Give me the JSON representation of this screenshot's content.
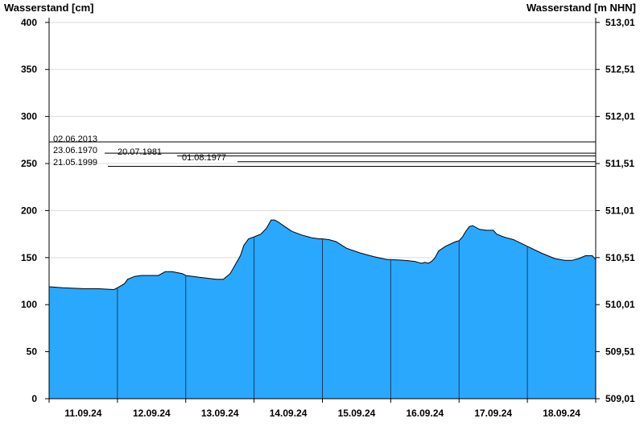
{
  "chart_data": {
    "type": "area",
    "title": "",
    "ylabel_left": "Wasserstand [cm]",
    "ylabel_right": "Wasserstand [m NHN]",
    "ylim": [
      0,
      405
    ],
    "yticks_left": [
      "0",
      "50",
      "100",
      "150",
      "200",
      "250",
      "300",
      "350",
      "400"
    ],
    "yticks_right": [
      "509,01",
      "509,51",
      "510,01",
      "510,51",
      "511,01",
      "511,51",
      "512,01",
      "512,51",
      "513,01"
    ],
    "x_day_labels": [
      "11.09.24",
      "12.09.24",
      "13.09.24",
      "14.09.24",
      "15.09.24",
      "16.09.24",
      "17.09.24",
      "18.09.24"
    ],
    "x_range_days": [
      0,
      8
    ],
    "grid": true,
    "fill_color": "#2aa8fe",
    "line_color": "#000000",
    "series": [
      {
        "x": [
          0,
          0.2,
          0.5,
          0.7,
          0.95,
          1.0,
          1.1,
          1.15,
          1.25,
          1.35,
          1.5,
          1.6,
          1.7,
          1.8,
          1.95,
          2.0,
          2.2,
          2.45,
          2.55,
          2.65,
          2.72,
          2.8,
          2.85,
          2.92,
          3.0,
          3.1,
          3.18,
          3.25,
          3.3,
          3.35,
          3.45,
          3.55,
          3.7,
          3.85,
          3.95,
          4.0,
          4.1,
          4.2,
          4.35,
          4.55,
          4.75,
          4.95,
          5.0,
          5.2,
          5.35,
          5.4,
          5.45,
          5.5,
          5.55,
          5.6,
          5.65,
          5.7,
          5.8,
          5.95,
          6.0,
          6.05,
          6.1,
          6.15,
          6.2,
          6.3,
          6.4,
          6.5,
          6.55,
          6.65,
          6.8,
          7.0,
          7.2,
          7.4,
          7.55,
          7.65,
          7.75,
          7.85,
          7.95,
          8.0
        ],
        "y": [
          119,
          118,
          117,
          117,
          116,
          118,
          122,
          127,
          130,
          131,
          131,
          131,
          135,
          135,
          133,
          131,
          129,
          127,
          127,
          133,
          142,
          152,
          163,
          170,
          172,
          175,
          181,
          190,
          190,
          188,
          183,
          178,
          174,
          171,
          170,
          170,
          169,
          167,
          160,
          155,
          151,
          148,
          148,
          147,
          146,
          145,
          144,
          145,
          144,
          146,
          150,
          157,
          162,
          167,
          168,
          172,
          178,
          183,
          184,
          180,
          179,
          179,
          175,
          172,
          169,
          162,
          155,
          149,
          147,
          147,
          149,
          152,
          152,
          148
        ]
      }
    ],
    "historical_levels": [
      {
        "label": "02.06.2013",
        "value": 273
      },
      {
        "label": "23.06.1970",
        "value": 261
      },
      {
        "label": "20.07.1981",
        "value": 258
      },
      {
        "label": "01.08.1977",
        "value": 252
      },
      {
        "label": "21.05.1999",
        "value": 247
      }
    ]
  }
}
